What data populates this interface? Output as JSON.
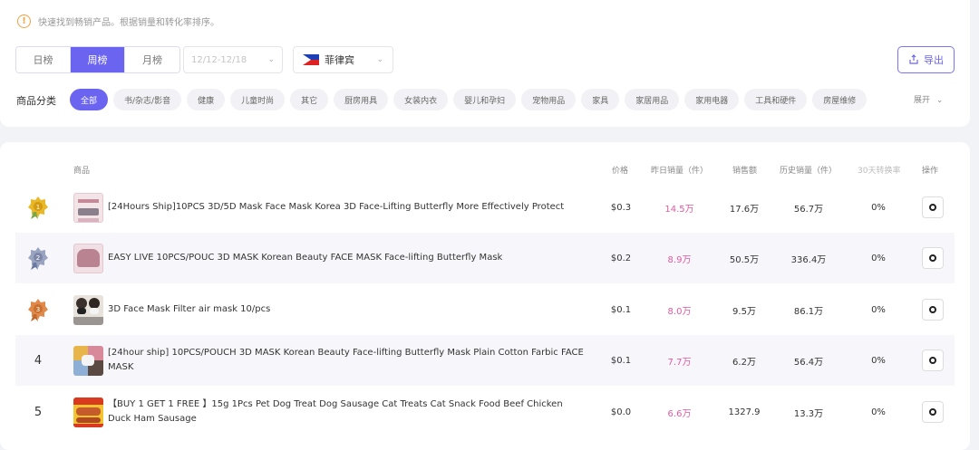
{
  "hint": {
    "text": "快速找到畅销产品。根据销量和转化率排序。",
    "icon": "exclamation-icon"
  },
  "period_tabs": [
    "日榜",
    "周榜",
    "月榜"
  ],
  "active_period": 1,
  "date_range": {
    "value": "12/12-12/18"
  },
  "country": {
    "label": "菲律宾",
    "icon": "philippines-flag-icon"
  },
  "export_label": "导出",
  "category": {
    "label": "商品分类",
    "items": [
      "全部",
      "书/杂志/影音",
      "健康",
      "儿童时尚",
      "其它",
      "厨房用具",
      "女装内衣",
      "婴儿和孕妇",
      "宠物用品",
      "家具",
      "家居用品",
      "家用电器",
      "工具和硬件",
      "房屋维修"
    ],
    "active": 0,
    "expand_label": "展开"
  },
  "table": {
    "headers": {
      "product": "商品",
      "price": "价格",
      "yesterday": "昨日销量（件）",
      "revenue": "销售额",
      "history": "历史销量（件）",
      "conversion": "30天转换率",
      "action": "操作"
    },
    "rows": [
      {
        "rank": "1",
        "medal": "gold",
        "name": "[24Hours Ship]10PCS 3D/5D Mask Face Mask Korea 3D Face-Lifting Butterfly More Effectively Protect",
        "price": "$0.3",
        "yesterday": "14.5万",
        "revenue": "17.6万",
        "history": "56.7万",
        "conversion": "0%"
      },
      {
        "rank": "2",
        "medal": "silver",
        "name": "EASY LIVE 10PCS/POUC 3D MASK Korean Beauty FACE MASK Face-lifting Butterfly Mask",
        "price": "$0.2",
        "yesterday": "8.9万",
        "revenue": "50.5万",
        "history": "336.4万",
        "conversion": "0%"
      },
      {
        "rank": "3",
        "medal": "bronze",
        "name": "3D Face Mask Filter air mask 10/pcs",
        "price": "$0.1",
        "yesterday": "8.0万",
        "revenue": "9.5万",
        "history": "86.1万",
        "conversion": "0%"
      },
      {
        "rank": "4",
        "medal": "",
        "name": "[24hour ship] 10PCS/POUCH 3D MASK Korean Beauty Face-lifting Butterfly Mask Plain Cotton Farbic FACE MASK",
        "price": "$0.1",
        "yesterday": "7.7万",
        "revenue": "6.2万",
        "history": "56.4万",
        "conversion": "0%"
      },
      {
        "rank": "5",
        "medal": "",
        "name": "【BUY 1 GET 1 FREE 】15g 1Pcs Pet Dog Treat Dog Sausage Cat Treats Cat Snack Food Beef Chicken Duck Ham Sausage",
        "price": "$0.0",
        "yesterday": "6.6万",
        "revenue": "1327.9",
        "history": "13.3万",
        "conversion": "0%"
      }
    ]
  },
  "colors": {
    "accent": "#6b64f0",
    "pink": "#e05aa0",
    "gold": "#e8b828",
    "silver": "#9aa4c0",
    "bronze": "#e0894a"
  }
}
